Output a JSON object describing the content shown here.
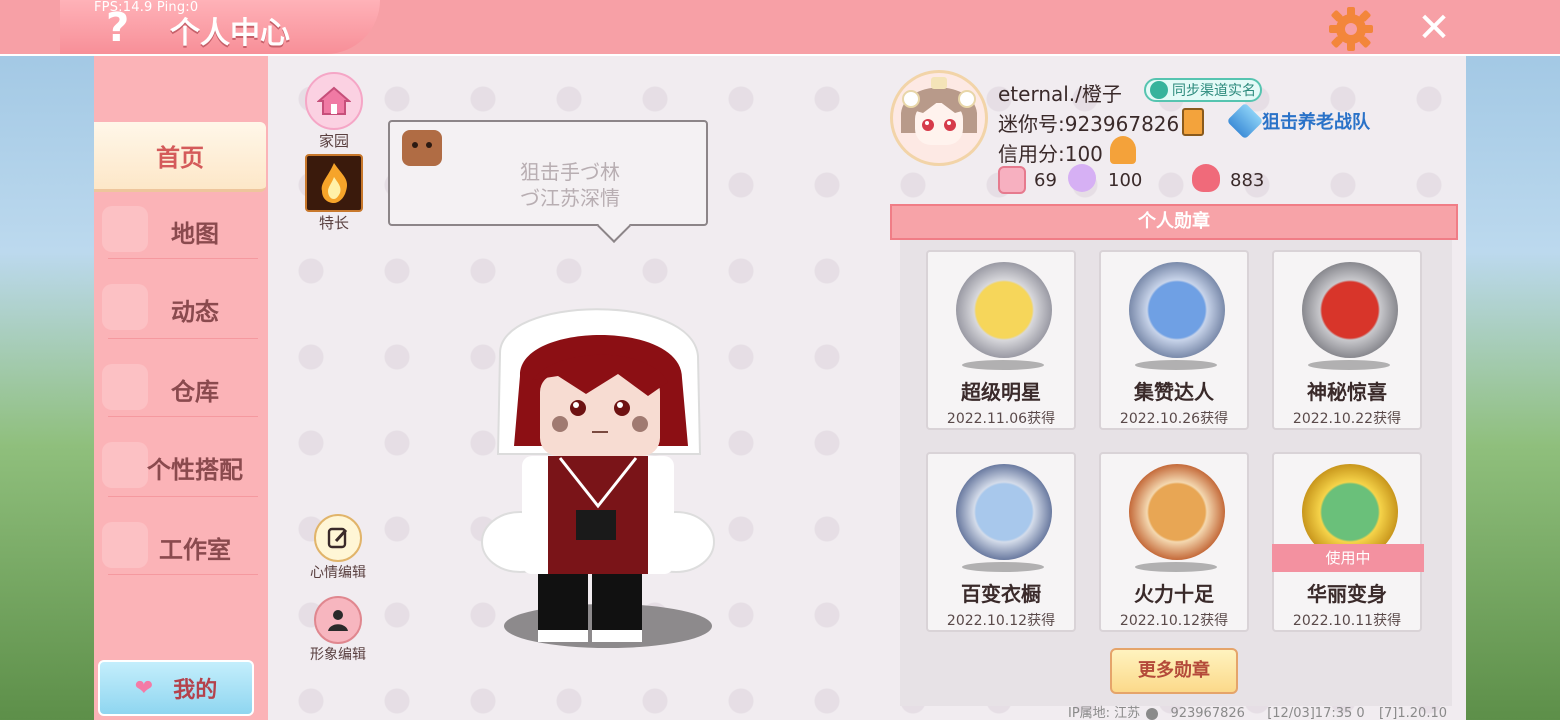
{
  "window": {
    "fps_overlay": "FPS:14.9  Ping:0",
    "title": "个人中心",
    "help_glyph": "?",
    "close_glyph": "✕"
  },
  "sidebar": {
    "items": [
      {
        "label": "首页",
        "active": true
      },
      {
        "label": "地图"
      },
      {
        "label": "动态"
      },
      {
        "label": "仓库"
      },
      {
        "label": "个性搭配"
      },
      {
        "label": "工作室"
      }
    ],
    "mine_label": "我的"
  },
  "quick_actions": {
    "home_label": "家园",
    "talent_label": "特长",
    "mood_edit_label": "心情编辑",
    "appearance_edit_label": "形象编辑"
  },
  "speech_bubble": {
    "line1": "狙击手づ林",
    "line2": "づ江苏深情"
  },
  "profile": {
    "nickname": "eternal./橙子",
    "verify_badge": "同步渠道实名",
    "mini_id": "迷你号:923967826",
    "team": "狙击养老战队",
    "credit": "信用分:100",
    "stats": {
      "likes": "69",
      "fans": "100",
      "popularity": "883"
    }
  },
  "medals": {
    "header": "个人勋章",
    "items": [
      {
        "name": "超级明星",
        "date": "2022.11.06获得"
      },
      {
        "name": "集赞达人",
        "date": "2022.10.26获得"
      },
      {
        "name": "神秘惊喜",
        "date": "2022.10.22获得"
      },
      {
        "name": "百变衣橱",
        "date": "2022.10.12获得"
      },
      {
        "name": "火力十足",
        "date": "2022.10.12获得"
      },
      {
        "name": "华丽变身",
        "date": "2022.10.11获得",
        "in_use_label": "使用中"
      }
    ],
    "more_label": "更多勋章"
  },
  "footer": {
    "ip_location": "IP属地: 江苏",
    "uid": "923967826",
    "timestamp": "[12/03]17:35 0",
    "version": "[7]1.20.10"
  },
  "colors": {
    "topbar": "#f7a0a6",
    "sidebar": "#fbb3b7",
    "panel": "#f1ecf0",
    "accent_red": "#d45a5a",
    "team_blue": "#2a72c8"
  }
}
